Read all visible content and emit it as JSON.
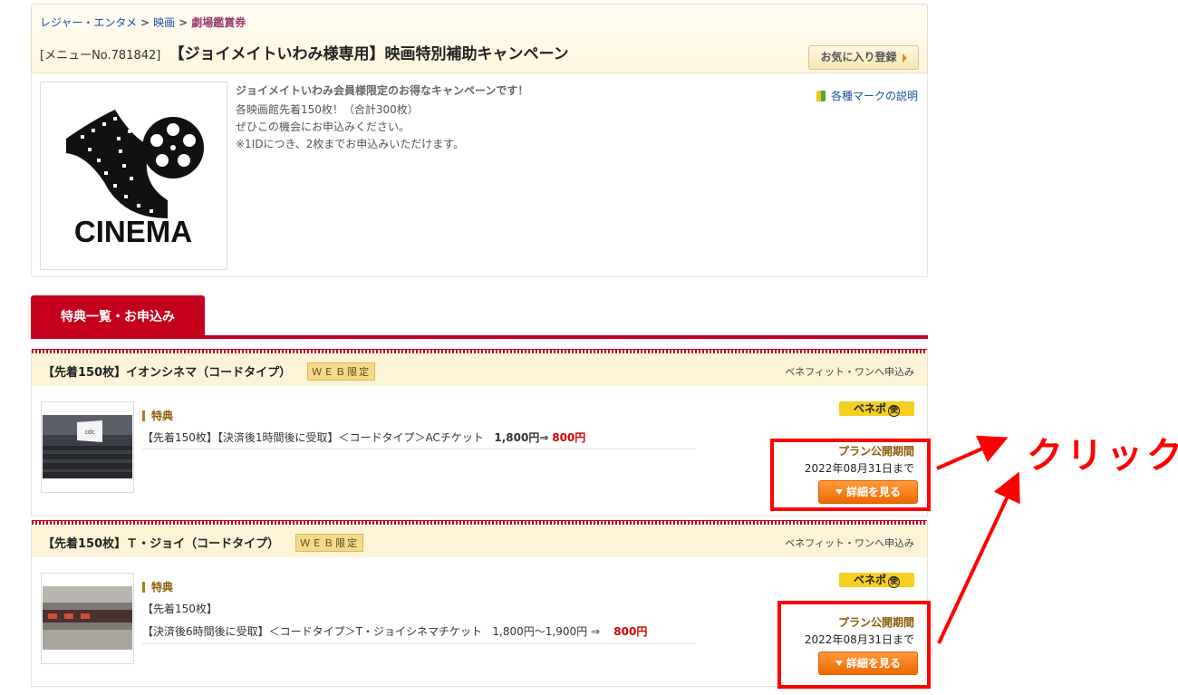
{
  "breadcrumb": {
    "items": [
      "レジャー・エンタメ",
      "映画"
    ],
    "current": "劇場鑑賞券",
    "separator": ">"
  },
  "header": {
    "menu_no": "[メニューNo.781842]",
    "title": "【ジョイメイトいわみ様専用】映画特別補助キャンペーン",
    "favorite_label": "お気に入り登録"
  },
  "summary": {
    "logo_text": "CINEMA",
    "lead": "ジョイメイトいわみ会員様限定のお得なキャンペーンです！",
    "lines": [
      "各映画館先着150枚！（合計300枚）",
      "ぜひこの機会にお申込みください。",
      "※1IDにつき、2枚までお申込みいただけます。"
    ],
    "marks_link": "各種マークの説明"
  },
  "tab": {
    "label": "特典一覧・お申込み"
  },
  "plans": [
    {
      "title": "【先着150枚】イオンシネマ（コードタイプ）",
      "badge": "ＷＥＢ限定",
      "apply_to": "ベネフィット・ワンへ申込み",
      "benefit_label": "特典",
      "benefit_lines": [
        "【先着150枚】【決済後1時間後に受取】＜コードタイプ＞ACチケット"
      ],
      "price": "1,800円⇒",
      "sale": "800円",
      "benepo": "ベネポ",
      "benepo_mark": "使",
      "period_label": "プラン公開期間",
      "period_date": "2022年08月31日まで",
      "detail_label": "詳細を見る",
      "thumb_label": "cdc"
    },
    {
      "title": "【先着150枚】Ｔ・ジョイ（コードタイプ）",
      "badge": "ＷＥＢ限定",
      "apply_to": "ベネフィット・ワンへ申込み",
      "benefit_label": "特典",
      "benefit_lines": [
        "【先着150枚】",
        "【決済後6時間後に受取】＜コードタイプ＞T・ジョイシネマチケット"
      ],
      "price": "1,800円～1,900円 ⇒",
      "sale": "800円",
      "benepo": "ベネポ",
      "benepo_mark": "使",
      "period_label": "プラン公開期間",
      "period_date": "2022年08月31日まで",
      "detail_label": "詳細を見る"
    }
  ],
  "annotation": {
    "text": "クリック"
  },
  "colors": {
    "accent_red": "#c4001e",
    "button_orange": "#ec6a00",
    "annotation_red": "#ff0000"
  }
}
